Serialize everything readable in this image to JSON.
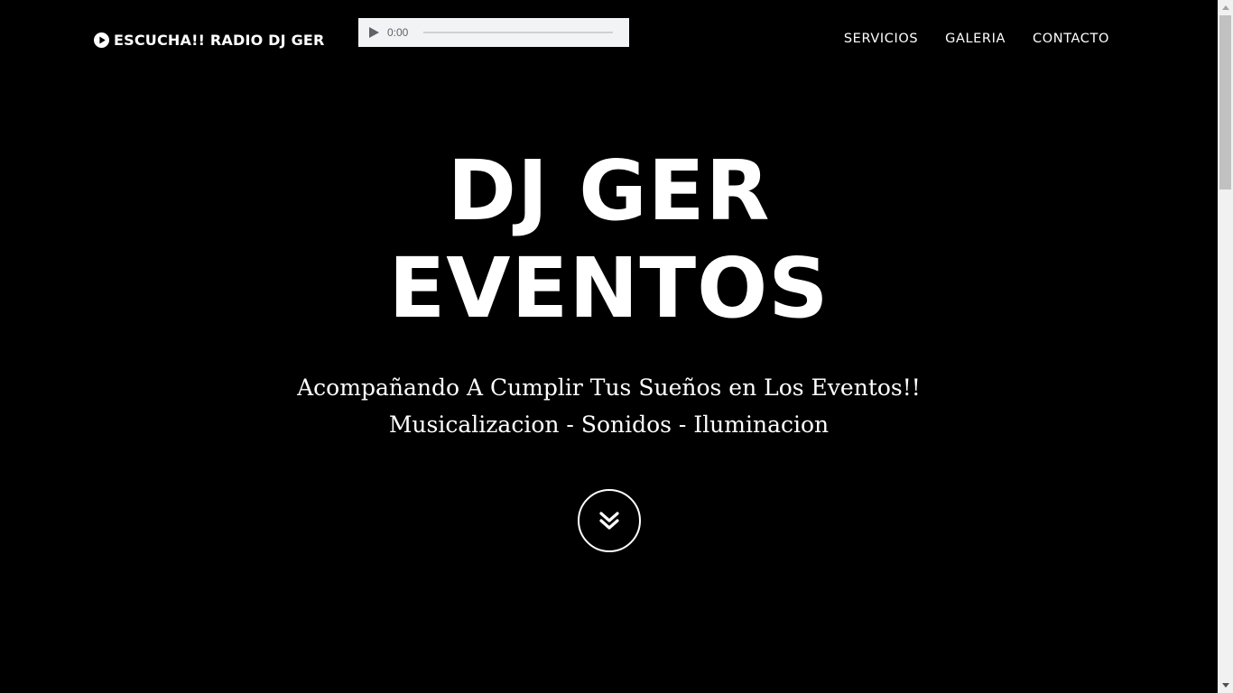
{
  "navbar": {
    "brand_icon": "play-circle-icon",
    "brand_text": "ESCUCHA!! RADIO DJ GER",
    "audio_player": {
      "time": "0:00",
      "play_icon": "play-icon",
      "progress": 0
    },
    "nav_items": [
      {
        "label": "SERVICIOS"
      },
      {
        "label": "GALERIA"
      },
      {
        "label": "CONTACTO"
      }
    ]
  },
  "hero": {
    "title_line1": "DJ GER",
    "title_line2": "EVENTOS",
    "subtitle_line1": "Acompañando A Cumplir Tus Sueños en Los Eventos!!",
    "subtitle_line2": "Musicalizacion - Sonidos - Iluminacion",
    "scroll_icon": "double-chevron-down-icon"
  },
  "colors": {
    "background": "#000000",
    "text": "#ffffff",
    "audio_player_bg": "#f1f3f4",
    "scrollbar_track": "#f1f1f1",
    "scrollbar_thumb": "#c1c1c1"
  }
}
